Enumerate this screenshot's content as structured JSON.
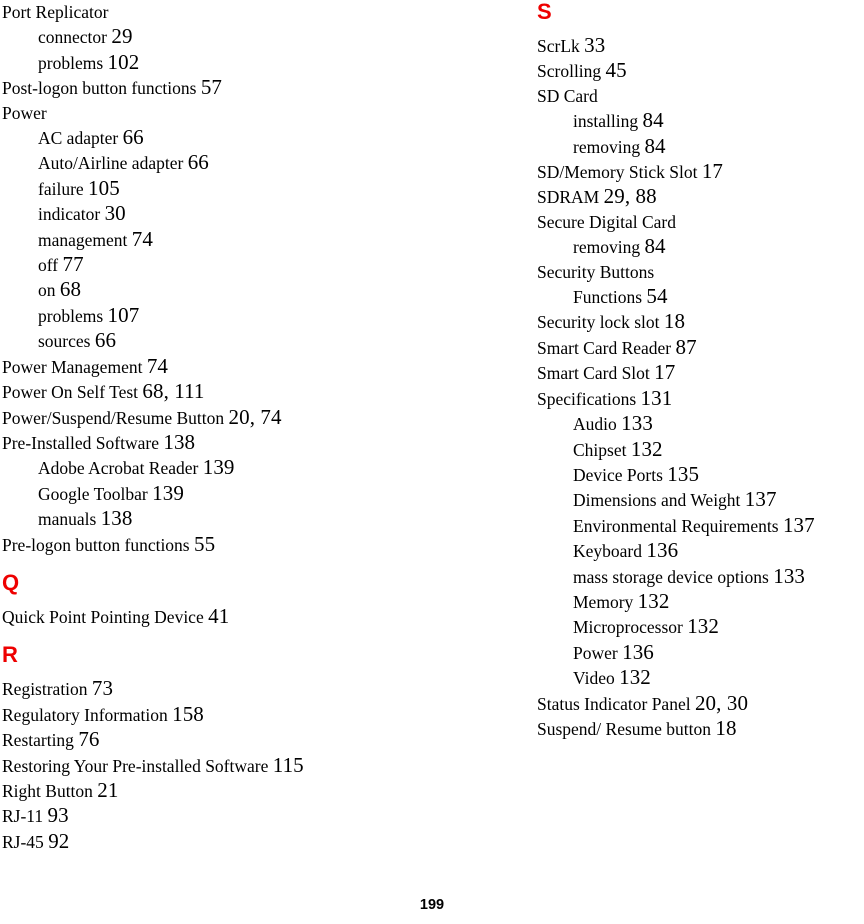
{
  "document": {
    "type": "index",
    "page_number": "199",
    "section_letter_color": "#ee0000"
  },
  "columns": {
    "left": {
      "blocks": [
        {
          "kind": "entries",
          "entries": [
            {
              "label": "Port Replicator",
              "pages": "",
              "level": 0
            },
            {
              "label": "connector",
              "pages": "29",
              "level": 1
            },
            {
              "label": "problems",
              "pages": "102",
              "level": 1
            },
            {
              "label": "Post-logon button functions",
              "pages": "57",
              "level": 0
            },
            {
              "label": "Power",
              "pages": "",
              "level": 0
            },
            {
              "label": "AC adapter",
              "pages": "66",
              "level": 1
            },
            {
              "label": "Auto/Airline adapter",
              "pages": "66",
              "level": 1
            },
            {
              "label": "failure",
              "pages": "105",
              "level": 1
            },
            {
              "label": "indicator",
              "pages": "30",
              "level": 1
            },
            {
              "label": "management",
              "pages": "74",
              "level": 1
            },
            {
              "label": "off",
              "pages": "77",
              "level": 1
            },
            {
              "label": "on",
              "pages": "68",
              "level": 1
            },
            {
              "label": "problems",
              "pages": "107",
              "level": 1
            },
            {
              "label": "sources",
              "pages": "66",
              "level": 1
            },
            {
              "label": "Power Management",
              "pages": "74",
              "level": 0
            },
            {
              "label": "Power On Self Test",
              "pages": "68, 111",
              "level": 0
            },
            {
              "label": "Power/Suspend/Resume Button",
              "pages": "20, 74",
              "level": 0
            },
            {
              "label": "Pre-Installed Software",
              "pages": "138",
              "level": 0
            },
            {
              "label": "Adobe Acrobat Reader",
              "pages": "139",
              "level": 1
            },
            {
              "label": "Google Toolbar",
              "pages": "139",
              "level": 1
            },
            {
              "label": "manuals",
              "pages": "138",
              "level": 1
            },
            {
              "label": "Pre-logon button functions",
              "pages": "55",
              "level": 0
            }
          ]
        },
        {
          "kind": "section",
          "letter": "Q"
        },
        {
          "kind": "entries",
          "entries": [
            {
              "label": "Quick Point Pointing Device",
              "pages": "41",
              "level": 0
            }
          ]
        },
        {
          "kind": "section",
          "letter": "R"
        },
        {
          "kind": "entries",
          "entries": [
            {
              "label": "Registration",
              "pages": "73",
              "level": 0
            },
            {
              "label": "Regulatory Information",
              "pages": "158",
              "level": 0
            },
            {
              "label": "Restarting",
              "pages": "76",
              "level": 0
            },
            {
              "label": "Restoring Your Pre-installed Software",
              "pages": "115",
              "level": 0
            },
            {
              "label": "Right Button",
              "pages": "21",
              "level": 0
            },
            {
              "label": "RJ-11",
              "pages": "93",
              "level": 0
            },
            {
              "label": "RJ-45",
              "pages": "92",
              "level": 0
            }
          ]
        }
      ]
    },
    "right": {
      "blocks": [
        {
          "kind": "section",
          "letter": "S",
          "first": true
        },
        {
          "kind": "entries",
          "entries": [
            {
              "label": "ScrLk",
              "pages": "33",
              "level": 0
            },
            {
              "label": "Scrolling",
              "pages": "45",
              "level": 0
            },
            {
              "label": "SD Card",
              "pages": "",
              "level": 0
            },
            {
              "label": "installing",
              "pages": "84",
              "level": 1
            },
            {
              "label": "removing",
              "pages": "84",
              "level": 1
            },
            {
              "label": "SD/Memory Stick Slot",
              "pages": "17",
              "level": 0
            },
            {
              "label": "SDRAM",
              "pages": "29, 88",
              "level": 0
            },
            {
              "label": "Secure Digital Card",
              "pages": "",
              "level": 0
            },
            {
              "label": "removing",
              "pages": "84",
              "level": 1
            },
            {
              "label": "Security Buttons",
              "pages": "",
              "level": 0
            },
            {
              "label": "Functions",
              "pages": "54",
              "level": 1
            },
            {
              "label": "Security lock slot",
              "pages": "18",
              "level": 0
            },
            {
              "label": "Smart Card Reader",
              "pages": "87",
              "level": 0
            },
            {
              "label": "Smart Card Slot",
              "pages": "17",
              "level": 0
            },
            {
              "label": "Specifications",
              "pages": "131",
              "level": 0
            },
            {
              "label": "Audio",
              "pages": "133",
              "level": 1
            },
            {
              "label": "Chipset",
              "pages": "132",
              "level": 1
            },
            {
              "label": "Device Ports",
              "pages": "135",
              "level": 1
            },
            {
              "label": "Dimensions and Weight",
              "pages": "137",
              "level": 1
            },
            {
              "label": "Environmental Requirements",
              "pages": "137",
              "level": 1
            },
            {
              "label": "Keyboard",
              "pages": "136",
              "level": 1
            },
            {
              "label": "mass storage device options",
              "pages": "133",
              "level": 1
            },
            {
              "label": "Memory",
              "pages": "132",
              "level": 1
            },
            {
              "label": "Microprocessor",
              "pages": "132",
              "level": 1
            },
            {
              "label": "Power",
              "pages": "136",
              "level": 1
            },
            {
              "label": "Video",
              "pages": "132",
              "level": 1
            },
            {
              "label": "Status Indicator Panel",
              "pages": "20, 30",
              "level": 0
            },
            {
              "label": "Suspend/ Resume button",
              "pages": "18",
              "level": 0
            }
          ]
        }
      ]
    }
  }
}
